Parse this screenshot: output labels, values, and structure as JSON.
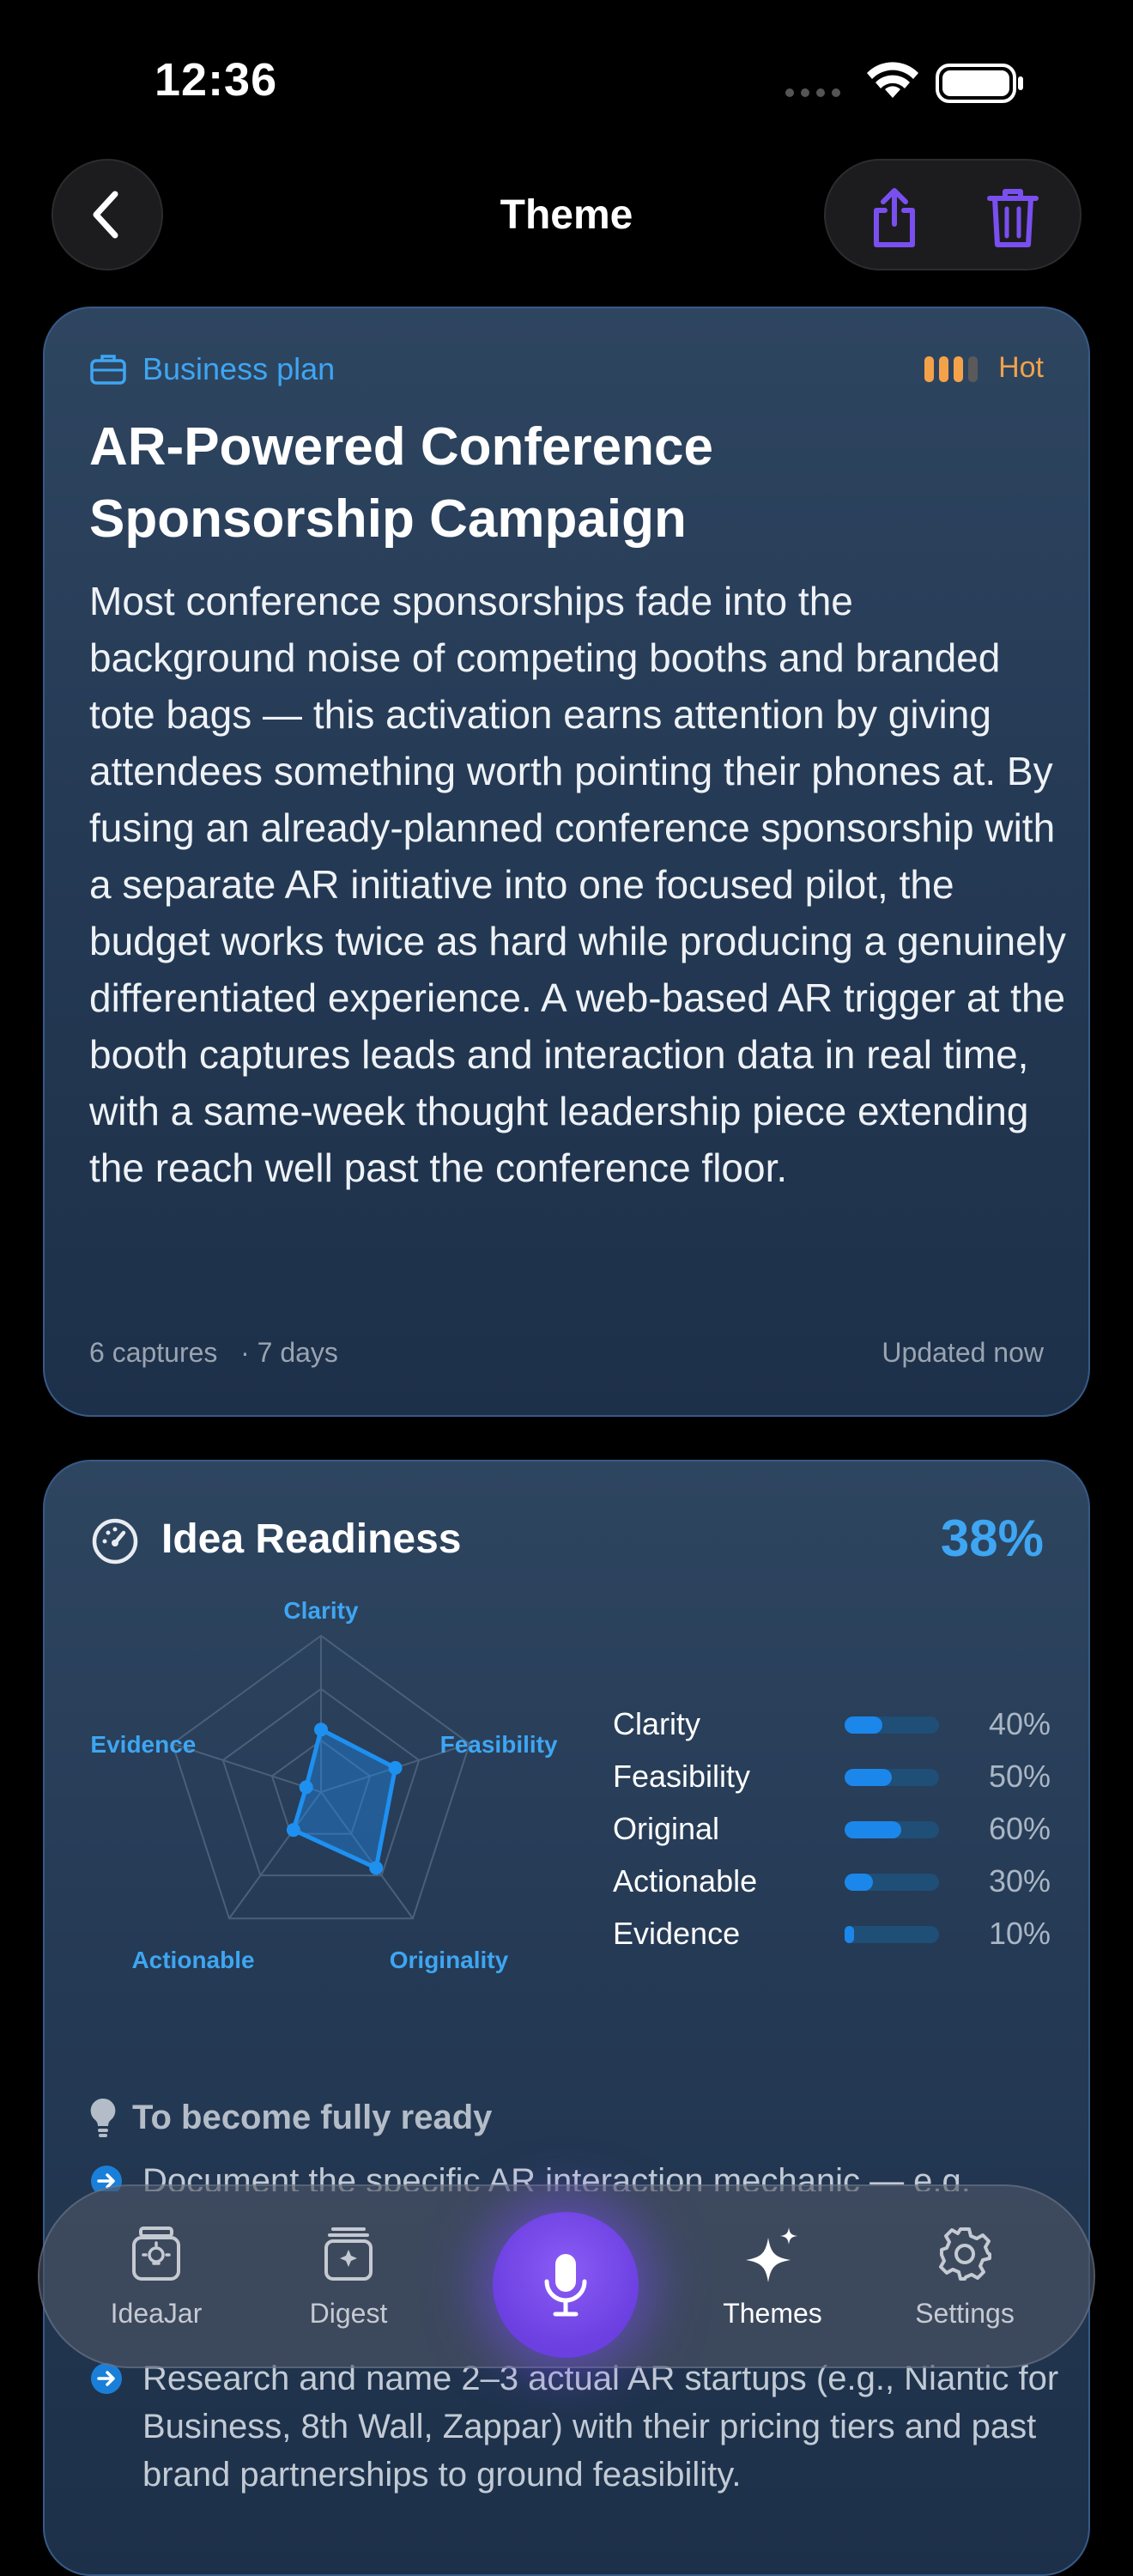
{
  "status_bar": {
    "time": "12:36"
  },
  "nav": {
    "title": "Theme"
  },
  "theme": {
    "category": "Business plan",
    "heat": "Hot",
    "title": "AR-Powered Conference Sponsorship Campaign",
    "description": "Most conference sponsorships fade into the background noise of competing booths and branded tote bags — this activation earns attention by giving attendees something worth pointing their phones at. By fusing an already-planned conference sponsorship with a separate AR initiative into one focused pilot, the budget works twice as hard while producing a genuinely differentiated experience. A web-based AR trigger at the booth captures leads and interaction data in real time, with a same-week thought leadership piece extending the reach well past the conference floor.",
    "captures": "6 captures",
    "duration": "· 7 days",
    "updated": "Updated now"
  },
  "readiness": {
    "title": "Idea Readiness",
    "percent": "38%",
    "radar_labels": {
      "clarity": "Clarity",
      "feasibility": "Feasibility",
      "originality": "Originality",
      "actionable": "Actionable",
      "evidence": "Evidence"
    },
    "metrics": [
      {
        "name": "Clarity",
        "value": 0.4,
        "label": "40%"
      },
      {
        "name": "Feasibility",
        "value": 0.5,
        "label": "50%"
      },
      {
        "name": "Original",
        "value": 0.6,
        "label": "60%"
      },
      {
        "name": "Actionable",
        "value": 0.3,
        "label": "30%"
      },
      {
        "name": "Evidence",
        "value": 0.1,
        "label": "10%"
      }
    ],
    "to_ready_title": "To become fully ready",
    "suggestions": [
      "Document the specific AR interaction mechanic — e.g.",
      "Research and name 2–3 actual AR startups (e.g., Niantic for Business, 8th Wall, Zappar) with their pricing tiers and past brand partnerships to ground feasibility."
    ]
  },
  "tabs": [
    {
      "label": "IdeaJar",
      "icon": "jar-icon"
    },
    {
      "label": "Digest",
      "icon": "digest-icon"
    },
    {
      "label": "Themes",
      "icon": "sparkles-icon",
      "active": true
    },
    {
      "label": "Settings",
      "icon": "gear-icon"
    }
  ],
  "colors": {
    "accent": "#3ea6f2",
    "hot": "#f0a24b",
    "mic": "#6b3fe0",
    "action_icons": "#7a4ff0"
  }
}
